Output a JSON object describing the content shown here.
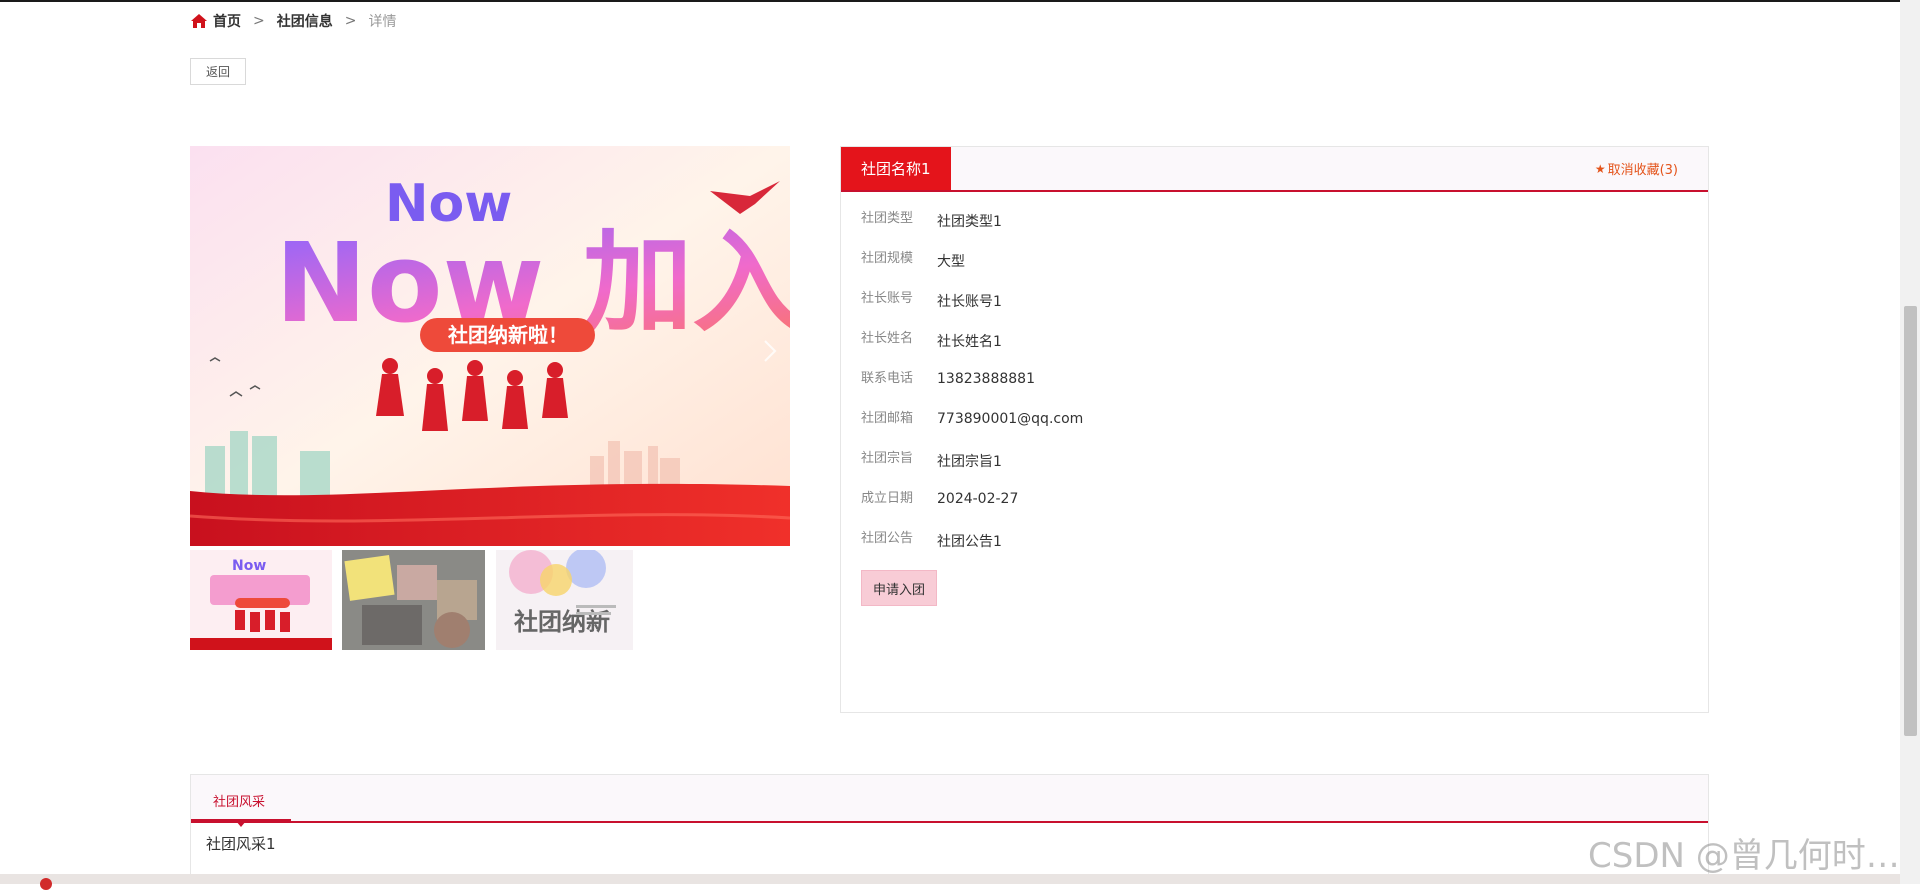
{
  "breadcrumb": {
    "home": "首页",
    "separator": ">",
    "section": "社团信息",
    "current": "详情"
  },
  "back_label": "返回",
  "club": {
    "name": "社团名称1",
    "favorite_label": "取消收藏(3)",
    "fields": [
      {
        "label": "社团类型",
        "value": "社团类型1"
      },
      {
        "label": "社团规模",
        "value": "大型"
      },
      {
        "label": "社长账号",
        "value": "社长账号1"
      },
      {
        "label": "社长姓名",
        "value": "社长姓名1"
      },
      {
        "label": "联系电话",
        "value": "13823888881"
      },
      {
        "label": "社团邮箱",
        "value": "773890001@qq.com"
      },
      {
        "label": "社团宗旨",
        "value": "社团宗旨1"
      },
      {
        "label": "成立日期",
        "value": "2024-02-27"
      },
      {
        "label": "社团公告",
        "value": "社团公告1"
      }
    ],
    "apply_label": "申请入团"
  },
  "gallery": {
    "main_banner_text": "Now 加入我们",
    "main_banner_sub": "社团纳新啦！",
    "thumb3_text": "社团纳新"
  },
  "bottom_tabs": {
    "active_tab": "社团风采",
    "content": "社团风采1"
  },
  "watermark": "CSDN @曾几何时…",
  "colors": {
    "primary": "#e4141b",
    "accent_line": "#c8102e",
    "favorite": "#e4541b",
    "apply_bg": "#f8ccd6"
  }
}
